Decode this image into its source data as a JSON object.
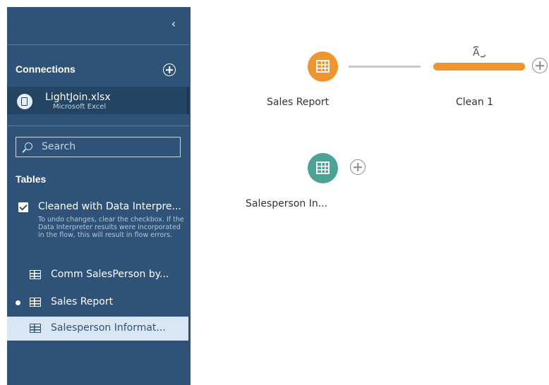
{
  "sidebar": {
    "collapse_glyph": "‹",
    "connections_header": "Connections",
    "connection": {
      "name": "LightJoin.xlsx",
      "type": "Microsoft Excel",
      "icon": "document-icon"
    },
    "search": {
      "placeholder": "Search"
    },
    "tables_header": "Tables",
    "interpreter": {
      "label": "Cleaned with Data Interpre...",
      "checked": true,
      "help": "To undo changes, clear the checkbox. If the Data Interpreter results were incorporated in the flow, this will result in flow errors."
    },
    "tables": [
      {
        "label": "Comm SalesPerson by...",
        "in_flow": false,
        "selected": false
      },
      {
        "label": "Sales Report",
        "in_flow": true,
        "selected": false
      },
      {
        "label": "Salesperson Informat...",
        "in_flow": false,
        "selected": true
      }
    ]
  },
  "canvas": {
    "nodes": [
      {
        "label": "Sales Report",
        "color": "#f0952e",
        "icon": "table-icon"
      },
      {
        "label": "Clean 1",
        "color": "#f0952e",
        "icon": "clean-icon"
      },
      {
        "label": "Salesperson In...",
        "color": "#4aa394",
        "icon": "table-icon"
      }
    ],
    "connector_color": "#c8c8c8"
  },
  "colors": {
    "sidebar_bg": "#2f5378",
    "selected_bg": "#d9e6f3",
    "orange": "#f0952e",
    "teal": "#4aa394"
  }
}
